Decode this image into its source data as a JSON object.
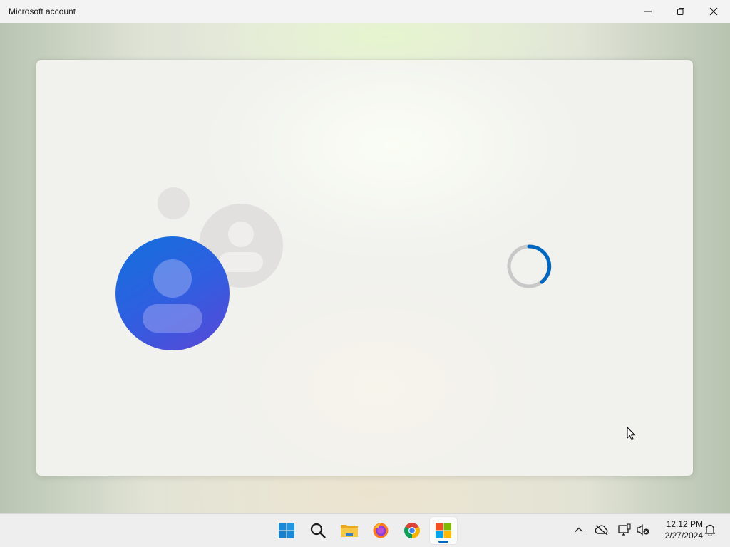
{
  "window": {
    "title": "Microsoft account",
    "controls": [
      "minimize",
      "restore",
      "close"
    ]
  },
  "card": {
    "illustration": "account-avatars",
    "loading": true,
    "colors": {
      "avatar_gradient_start": "#1270dc",
      "avatar_gradient_end": "#5a47d6",
      "spinner_accent": "#0067c0",
      "spinner_track": "#c8c8c8"
    }
  },
  "taskbar": {
    "apps": [
      {
        "name": "Start",
        "icon": "windows-logo-icon"
      },
      {
        "name": "Search",
        "icon": "search-icon"
      },
      {
        "name": "File Explorer",
        "icon": "folder-icon"
      },
      {
        "name": "Firefox",
        "icon": "firefox-icon"
      },
      {
        "name": "Chrome",
        "icon": "chrome-icon"
      },
      {
        "name": "Microsoft Store",
        "icon": "store-icon",
        "active": true
      }
    ],
    "tray": {
      "icons": [
        "chevron-up-icon",
        "onedrive-icon",
        "network-icon",
        "volume-muted-icon",
        "notification-bell-icon"
      ],
      "time": "12:12 PM",
      "date": "2/27/2024"
    }
  }
}
